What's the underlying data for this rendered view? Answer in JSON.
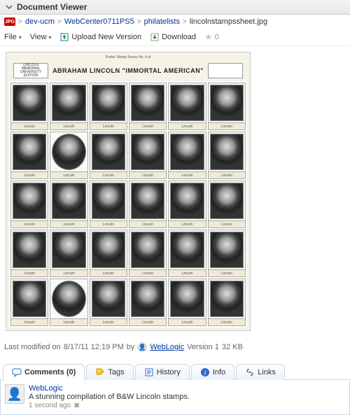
{
  "header": {
    "title": "Document Viewer"
  },
  "breadcrumbs": {
    "items": [
      {
        "label": "dev-ucm",
        "link": true
      },
      {
        "label": "WebCenter0711PS5",
        "link": true
      },
      {
        "label": "philatelists",
        "link": true
      },
      {
        "label": "lincolnstampssheet.jpg",
        "link": false
      }
    ],
    "separator": ">"
  },
  "toolbar": {
    "file": "File",
    "view": "View",
    "upload": "Upload New Version",
    "download": "Download",
    "likes": "0"
  },
  "image": {
    "subtitle": "Poster Stamp Series No. 4 of",
    "title": "ABRAHAM LINCOLN \"IMMORTAL AMERICAN\"",
    "badge_left": "LINCOLN MEMORIAL UNIVERSITY EDITION",
    "stamp_label": "Lincoln"
  },
  "meta": {
    "prefix": "Last modified on",
    "date": "8/17/11 12:19 PM",
    "by": "by",
    "user": "WebLogic",
    "version": "Version 1",
    "size": "32 KB"
  },
  "tabs": {
    "comments": "Comments (0)",
    "tags": "Tags",
    "history": "History",
    "info": "Info",
    "links": "Links"
  },
  "comment": {
    "user": "WebLogic",
    "text": "A stunning compilation of B&W Lincoln stamps.",
    "time": "1 second ago"
  }
}
